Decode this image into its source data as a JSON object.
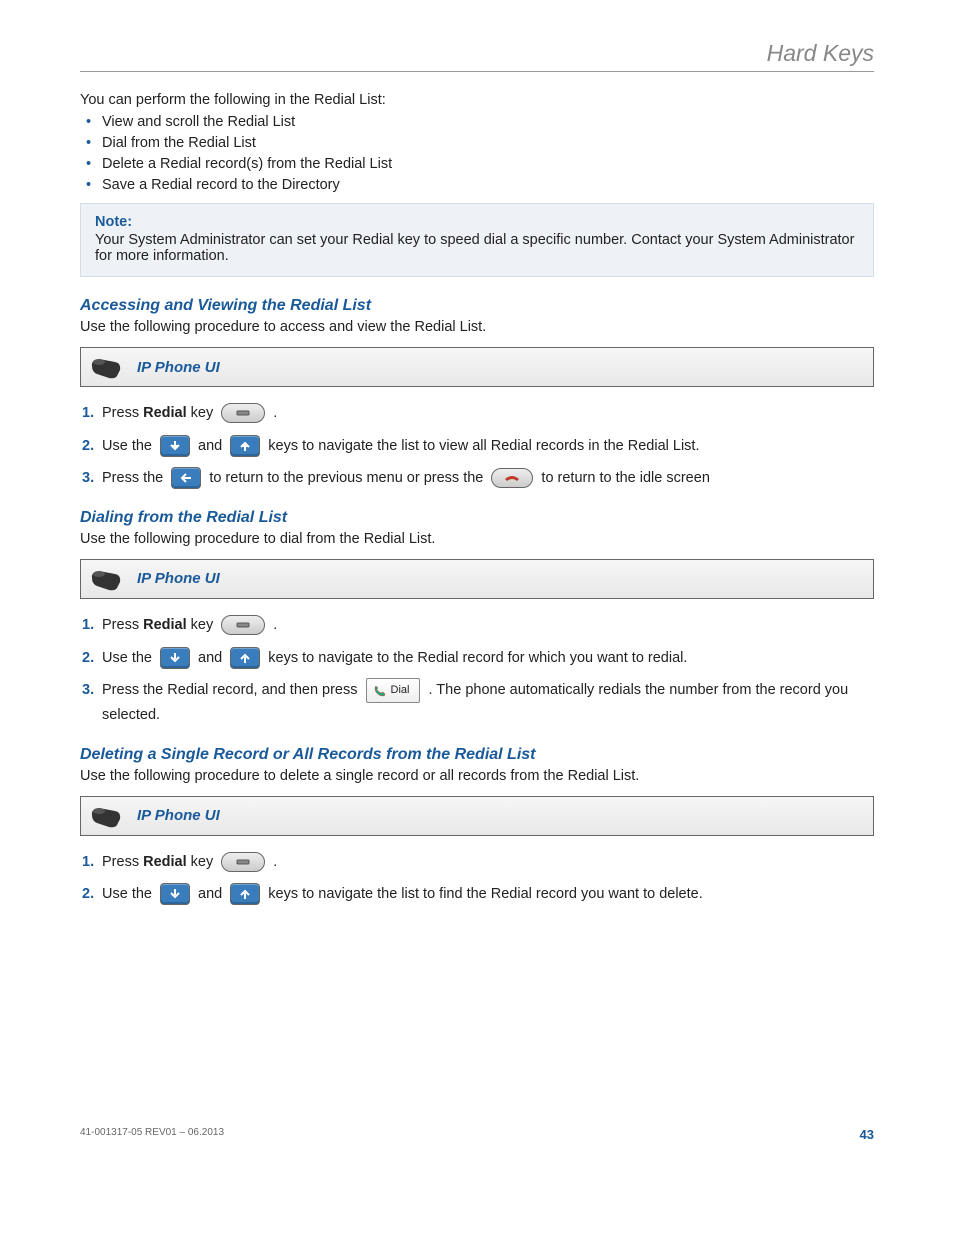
{
  "header": "Hard Keys",
  "intro": "You can perform the following in the Redial List:",
  "bullets": [
    "View and scroll the Redial List",
    "Dial from the Redial List",
    "Delete a Redial record(s) from the Redial List",
    "Save a Redial record to the Directory"
  ],
  "note": {
    "label": "Note:",
    "text": "Your System Administrator can set your Redial key to speed dial a specific number. Contact your System Administrator for more information."
  },
  "dial_label": "Dial",
  "sections": [
    {
      "title": "Accessing and Viewing the Redial List",
      "desc": "Use the following procedure to access and view the Redial List.",
      "ui_label": "IP Phone UI",
      "steps": [
        {
          "num": "1",
          "pre": "Press ",
          "bold": "Redial",
          "post": " key ",
          "tail": "."
        },
        {
          "num": "2",
          "pre": "Use the ",
          "mid": " and ",
          "post": " keys to navigate the list to view all Redial records in the Redial List."
        },
        {
          "num": "3",
          "pre": "Press the ",
          "mid": " to return to the previous menu or press the ",
          "post": " to return to the idle screen"
        }
      ]
    },
    {
      "title": "Dialing from the Redial List",
      "desc": "Use the following procedure to dial from the Redial List.",
      "ui_label": "IP Phone UI",
      "steps": [
        {
          "num": "1",
          "pre": "Press ",
          "bold": "Redial",
          "post": " key ",
          "tail": "."
        },
        {
          "num": "2",
          "pre": "Use the ",
          "mid": " and ",
          "post": " keys to navigate to the Redial record for which you want to redial."
        },
        {
          "num": "3",
          "pre": "Press the Redial record, and then press ",
          "post": " . The phone automatically redials the number from the record you selected."
        }
      ]
    },
    {
      "title": "Deleting a Single Record or All Records from the Redial List",
      "desc": "Use the following procedure to delete a single record or all records from the Redial List.",
      "ui_label": "IP Phone UI",
      "steps": [
        {
          "num": "1",
          "pre": "Press ",
          "bold": "Redial",
          "post": " key ",
          "tail": "."
        },
        {
          "num": "2",
          "pre": "Use the ",
          "mid": " and ",
          "post": " keys to navigate the list to find the Redial record you want to delete."
        }
      ]
    }
  ],
  "footer": {
    "doc": "41-001317-05 REV01 – 06.2013",
    "page": "43"
  }
}
